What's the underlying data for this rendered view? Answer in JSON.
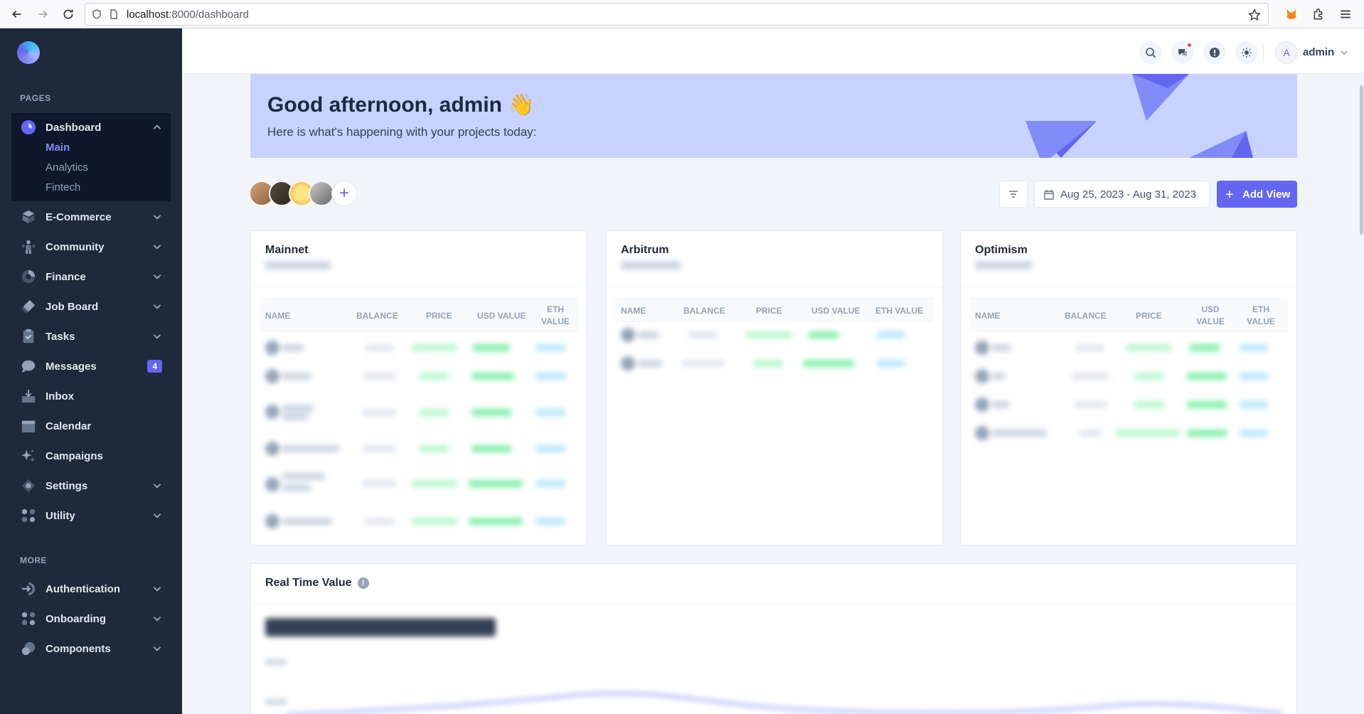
{
  "browser": {
    "url_host": "localhost",
    "url_path": ":8000/dashboard"
  },
  "sidebar": {
    "pages_title": "PAGES",
    "more_title": "MORE",
    "dashboard": {
      "label": "Dashboard",
      "sub": [
        "Main",
        "Analytics",
        "Fintech"
      ]
    },
    "items": [
      {
        "label": "E-Commerce",
        "icon": "box-icon"
      },
      {
        "label": "Community",
        "icon": "people-icon"
      },
      {
        "label": "Finance",
        "icon": "pie-icon"
      },
      {
        "label": "Job Board",
        "icon": "tag-icon"
      },
      {
        "label": "Tasks",
        "icon": "clipboard-icon"
      },
      {
        "label": "Messages",
        "icon": "chat-icon",
        "badge": "4"
      },
      {
        "label": "Inbox",
        "icon": "inbox-icon"
      },
      {
        "label": "Calendar",
        "icon": "calendar-icon"
      },
      {
        "label": "Campaigns",
        "icon": "sparkle-icon"
      },
      {
        "label": "Settings",
        "icon": "wrench-icon"
      },
      {
        "label": "Utility",
        "icon": "grid-icon"
      }
    ],
    "more_items": [
      {
        "label": "Authentication",
        "icon": "login-icon"
      },
      {
        "label": "Onboarding",
        "icon": "nodes-icon"
      },
      {
        "label": "Components",
        "icon": "circles-icon"
      }
    ]
  },
  "header": {
    "user_initial": "A",
    "user_name": "admin"
  },
  "banner": {
    "title": "Good afternoon, admin 👋",
    "subtitle": "Here is what's happening with your projects today:"
  },
  "toolbar": {
    "date_range": "Aug 25, 2023 - Aug 31, 2023",
    "add_view": "Add View",
    "add_symbol": "+"
  },
  "cards": [
    {
      "title": "Mainnet",
      "headers": [
        "NAME",
        "BALANCE",
        "PRICE",
        "USD VALUE",
        "ETH VALUE"
      ]
    },
    {
      "title": "Arbitrum",
      "headers": [
        "NAME",
        "BALANCE",
        "PRICE",
        "USD VALUE",
        "ETH VALUE"
      ]
    },
    {
      "title": "Optimism",
      "headers": [
        "NAME",
        "BALANCE",
        "PRICE",
        "USD VALUE",
        "ETH VALUE"
      ]
    }
  ],
  "realtime": {
    "title": "Real Time Value",
    "info": "!"
  },
  "colors": {
    "accent": "#6366f1",
    "sidebar_bg": "#1e293b",
    "banner_bg": "#c7d2fe"
  }
}
